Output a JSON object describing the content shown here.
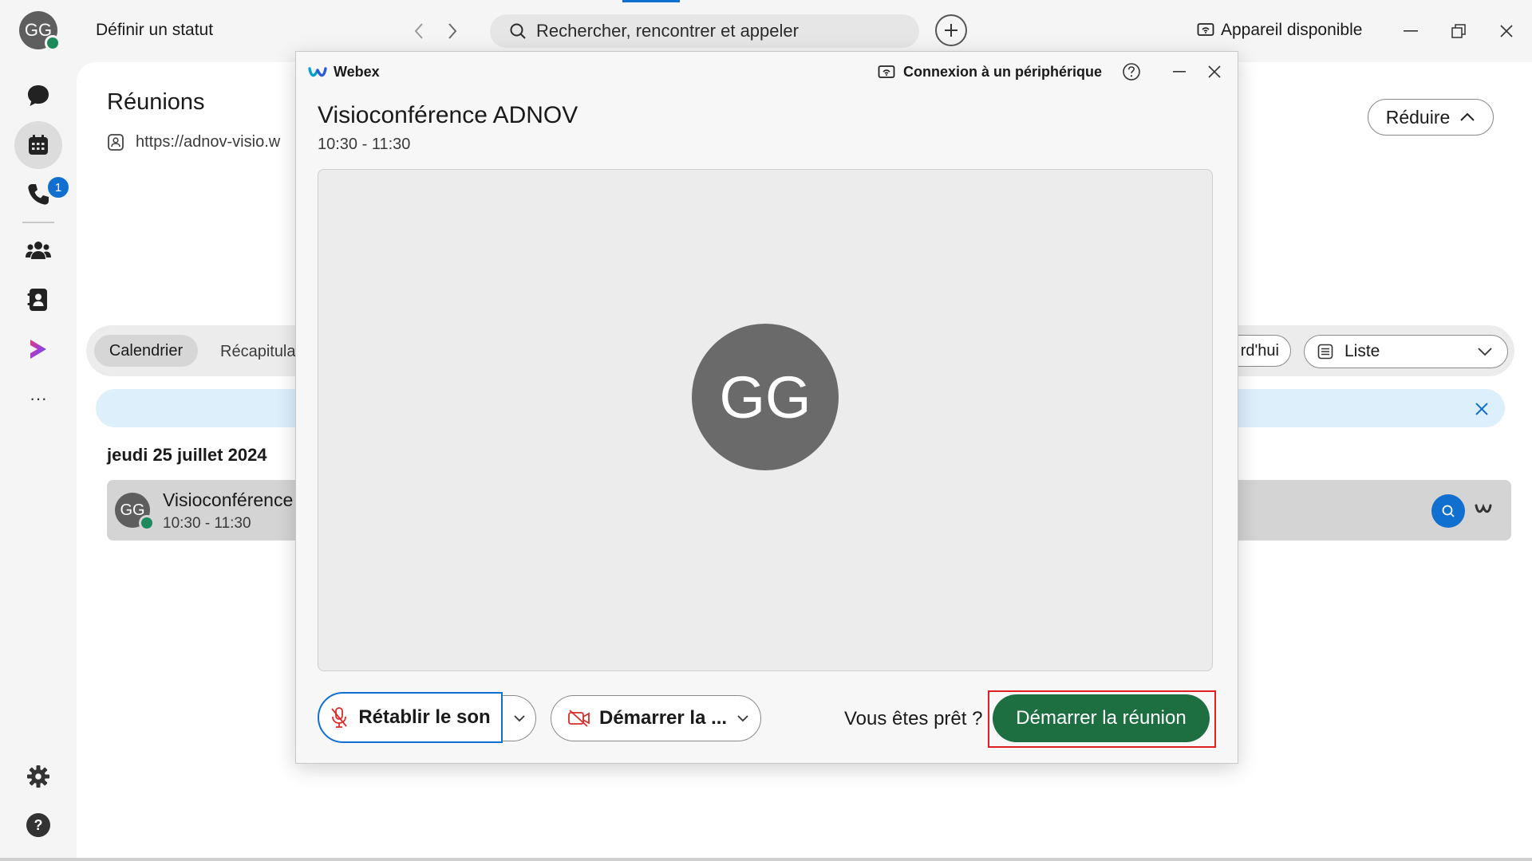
{
  "app": {
    "user_initials": "GG",
    "status_label": "Définir un statut",
    "search_placeholder": "Rechercher, rencontrer et appeler",
    "device_label": "Appareil disponible"
  },
  "sidebar": {
    "calls_badge": "1",
    "more_label": "···",
    "help_label": "?"
  },
  "main": {
    "title": "Réunions",
    "url": "https://adnov-visio.w",
    "collapse_label": "Réduire",
    "tabs": {
      "calendar": "Calendrier",
      "recap": "Récapitula"
    },
    "today_label": "rd'hui",
    "view_select": "Liste",
    "date_heading": "jeudi 25 juillet 2024",
    "meeting": {
      "initials": "GG",
      "title": "Visioconférence",
      "time": "10:30 - 11:30"
    }
  },
  "modal": {
    "app_name": "Webex",
    "connect_label": "Connexion à un périphérique",
    "title": "Visioconférence ADNOV",
    "time": "10:30 - 11:30",
    "preview_initials": "GG",
    "unmute_label": "Rétablir le son",
    "video_label": "Démarrer la ...",
    "ready_text": "Vous êtes prêt ?",
    "start_label": "Démarrer la réunion"
  },
  "colors": {
    "accent_blue": "#1170cf",
    "start_green": "#1d6f42",
    "highlight_red": "#e02020",
    "presence_green": "#1d8a5b",
    "mute_red": "#d92b2b"
  }
}
